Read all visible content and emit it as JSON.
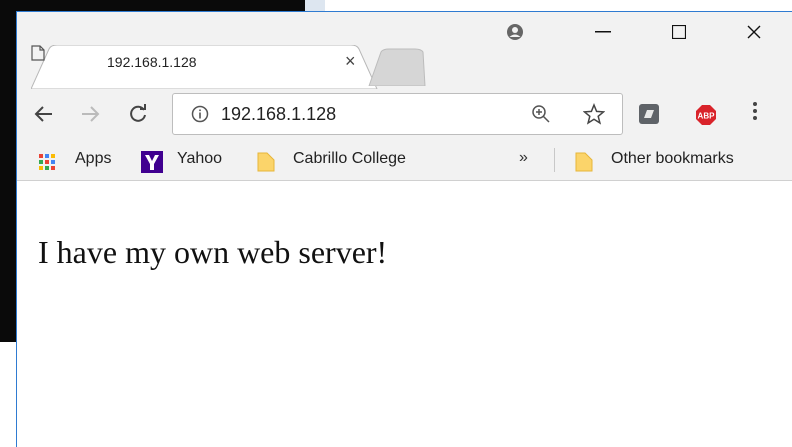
{
  "tab": {
    "title": "192.168.1.128",
    "close_symbol": "×"
  },
  "window_controls": {
    "minimize": "—",
    "maximize": "☐",
    "close": "✕"
  },
  "omnibox": {
    "url": "192.168.1.128"
  },
  "bookmarks": {
    "items": [
      {
        "label": "Apps",
        "icon": "apps-grid-icon"
      },
      {
        "label": "Yahoo",
        "icon": "yahoo-icon"
      },
      {
        "label": "Cabrillo College",
        "icon": "folder-icon"
      }
    ],
    "overflow_symbol": "»",
    "other_label": "Other bookmarks"
  },
  "page": {
    "text": "I have my own web server!"
  },
  "extensions": {
    "abp_label": "ABP"
  }
}
